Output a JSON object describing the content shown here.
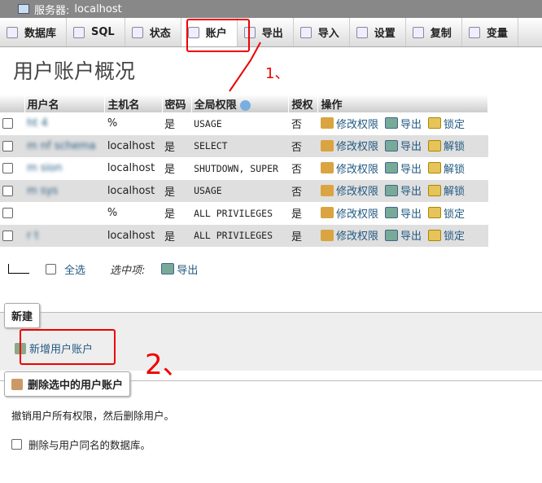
{
  "titlebar": {
    "label": "服务器:",
    "server": "localhost"
  },
  "tabs": [
    {
      "label": "数据库",
      "icon": "database-icon"
    },
    {
      "label": "SQL",
      "icon": "sql-icon"
    },
    {
      "label": "状态",
      "icon": "status-icon"
    },
    {
      "label": "账户",
      "icon": "accounts-icon"
    },
    {
      "label": "导出",
      "icon": "export-icon"
    },
    {
      "label": "导入",
      "icon": "import-icon"
    },
    {
      "label": "设置",
      "icon": "settings-icon"
    },
    {
      "label": "复制",
      "icon": "replication-icon"
    },
    {
      "label": "变量",
      "icon": "variables-icon"
    }
  ],
  "page_title": "用户账户概况",
  "table": {
    "headers": [
      "用户名",
      "主机名",
      "密码",
      "全局权限",
      "授权",
      "操作"
    ],
    "rows": [
      {
        "user": "ht  4",
        "host": "%",
        "password": "是",
        "priv": "USAGE",
        "grant": "否",
        "lock": "锁定"
      },
      {
        "user": "m   nf schema",
        "host": "localhost",
        "password": "是",
        "priv": "SELECT",
        "grant": "否",
        "lock": "解锁"
      },
      {
        "user": "m   sion",
        "host": "localhost",
        "password": "是",
        "priv": "SHUTDOWN, SUPER",
        "grant": "否",
        "lock": "解锁"
      },
      {
        "user": "m   sys",
        "host": "localhost",
        "password": "是",
        "priv": "USAGE",
        "grant": "否",
        "lock": "解锁"
      },
      {
        "user": "",
        "host": "%",
        "password": "是",
        "priv": "ALL PRIVILEGES",
        "grant": "是",
        "lock": "锁定"
      },
      {
        "user": "r  t",
        "host": "localhost",
        "password": "是",
        "priv": "ALL PRIVILEGES",
        "grant": "是",
        "lock": "锁定"
      }
    ],
    "edit_label": "修改权限",
    "export_label": "导出"
  },
  "bulk": {
    "select_all": "全选",
    "with_selected": "选中项:",
    "export": "导出"
  },
  "new_section": {
    "legend": "新建",
    "add_user": "新增用户账户"
  },
  "delete_section": {
    "legend": "删除选中的用户账户",
    "desc": "撤销用户所有权限，然后删除用户。",
    "drop_db": "删除与用户同名的数据库。"
  },
  "annotations": {
    "one": "1、",
    "two": "2、"
  },
  "colors": {
    "annotation": "#e00000",
    "link": "#235a81"
  }
}
